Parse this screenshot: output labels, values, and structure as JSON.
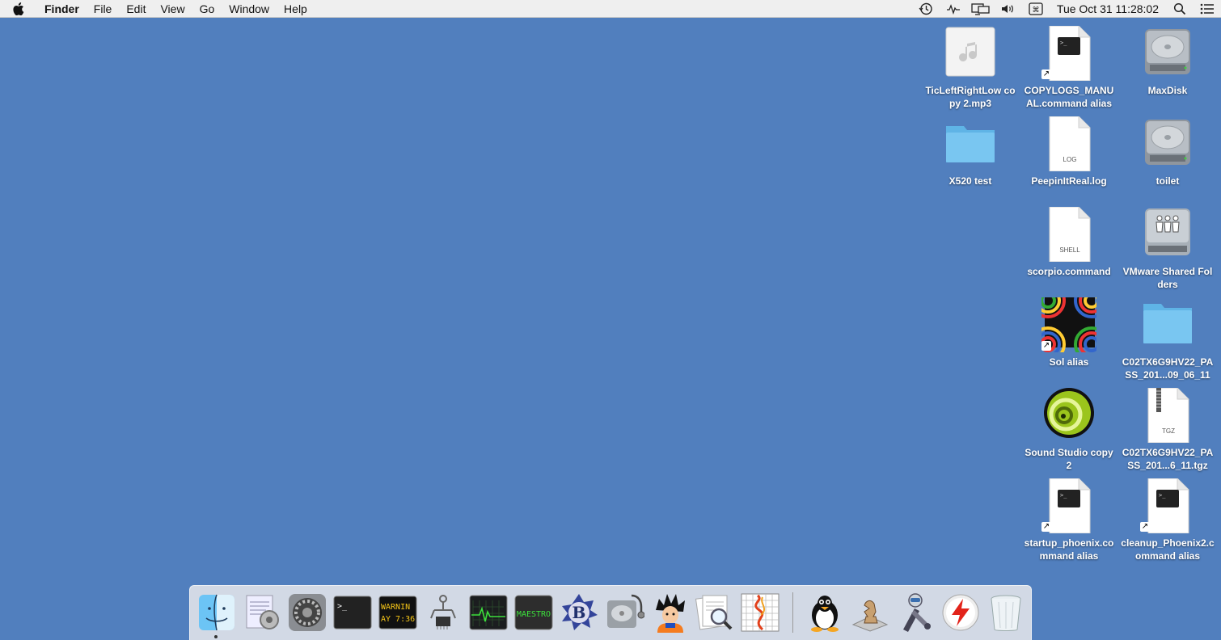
{
  "menubar": {
    "app_name": "Finder",
    "menus": [
      "File",
      "Edit",
      "View",
      "Go",
      "Window",
      "Help"
    ],
    "clock": "Tue Oct 31  11:28:02",
    "status_icons": [
      "time-machine-icon",
      "activity-icon",
      "display-mirroring-icon",
      "volume-icon",
      "input-menu-icon",
      "spotlight-icon",
      "notification-center-icon"
    ]
  },
  "desktop": {
    "background_color": "#517fbe",
    "icons": [
      {
        "label": "TicLeftRightLow copy 2.mp3",
        "type": "audio-file"
      },
      {
        "label": "COPYLOGS_MANUAL.command alias",
        "type": "terminal-alias"
      },
      {
        "label": "MaxDisk",
        "type": "disk"
      },
      {
        "label": "X520 test",
        "type": "folder"
      },
      {
        "label": "PeepinItReal.log",
        "type": "document",
        "badge": "LOG"
      },
      {
        "label": "toilet",
        "type": "disk"
      },
      {
        "label": "scorpio.command",
        "type": "document",
        "badge": "SHELL"
      },
      {
        "label": "VMware Shared Folders",
        "type": "shared-disk"
      },
      {
        "label": "Sol alias",
        "type": "sol-alias"
      },
      {
        "label": "C02TX6G9HV22_PASS_201...09_06_11",
        "type": "folder"
      },
      {
        "label": "Sound Studio copy 2",
        "type": "sound-studio"
      },
      {
        "label": "C02TX6G9HV22_PASS_201...6_11.tgz",
        "type": "archive",
        "badge": "TGZ"
      },
      {
        "label": "startup_phoenix.command alias",
        "type": "terminal-alias"
      },
      {
        "label": "cleanup_Phoenix2.command alias",
        "type": "terminal-alias"
      }
    ]
  },
  "dock": {
    "items": [
      {
        "name": "Finder",
        "icon": "finder-icon",
        "running": true
      },
      {
        "name": "Script Utility",
        "icon": "script-utility-icon"
      },
      {
        "name": "System Preferences",
        "icon": "system-preferences-icon"
      },
      {
        "name": "Terminal",
        "icon": "terminal-icon"
      },
      {
        "name": "Console",
        "icon": "console-icon",
        "text": "WARNIN AY 7:36"
      },
      {
        "name": "System Information",
        "icon": "system-information-icon"
      },
      {
        "name": "Activity Monitor",
        "icon": "activity-monitor-icon"
      },
      {
        "name": "Maestro",
        "icon": "maestro-icon",
        "text": "MAESTRO"
      },
      {
        "name": "BBEdit",
        "icon": "bbedit-icon",
        "text": "B"
      },
      {
        "name": "Disk Utility",
        "icon": "disk-utility-icon"
      },
      {
        "name": "Goku",
        "icon": "goku-icon"
      },
      {
        "name": "Preview",
        "icon": "preview-icon"
      },
      {
        "name": "Grapher",
        "icon": "grapher-icon"
      },
      {
        "name": "Tux",
        "icon": "tux-icon"
      },
      {
        "name": "Chess",
        "icon": "chess-icon"
      },
      {
        "name": "Automator",
        "icon": "automator-icon"
      },
      {
        "name": "Flash",
        "icon": "flash-icon"
      },
      {
        "name": "Trash",
        "icon": "trash-icon"
      }
    ]
  }
}
